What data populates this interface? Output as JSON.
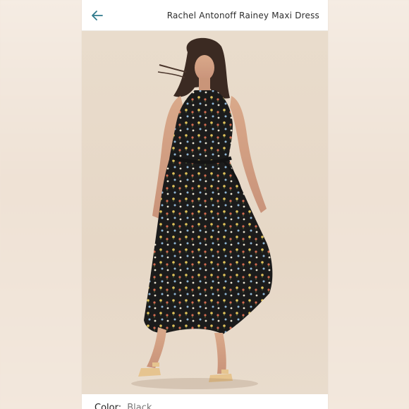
{
  "header": {
    "back_icon": "arrow-left-icon",
    "title": "Rachel Antonoff Rainey Maxi Dress"
  },
  "product": {
    "image_alt": "Model wearing a black floral maxi dress with tie waist and strappy sandals"
  },
  "details": {
    "color_label": "Color:",
    "color_value": "Black"
  },
  "colors": {
    "accent": "#2f7a8c",
    "background": "#f1e7dc",
    "header_bg": "#ffffff",
    "dress": "#1c1c1c"
  }
}
